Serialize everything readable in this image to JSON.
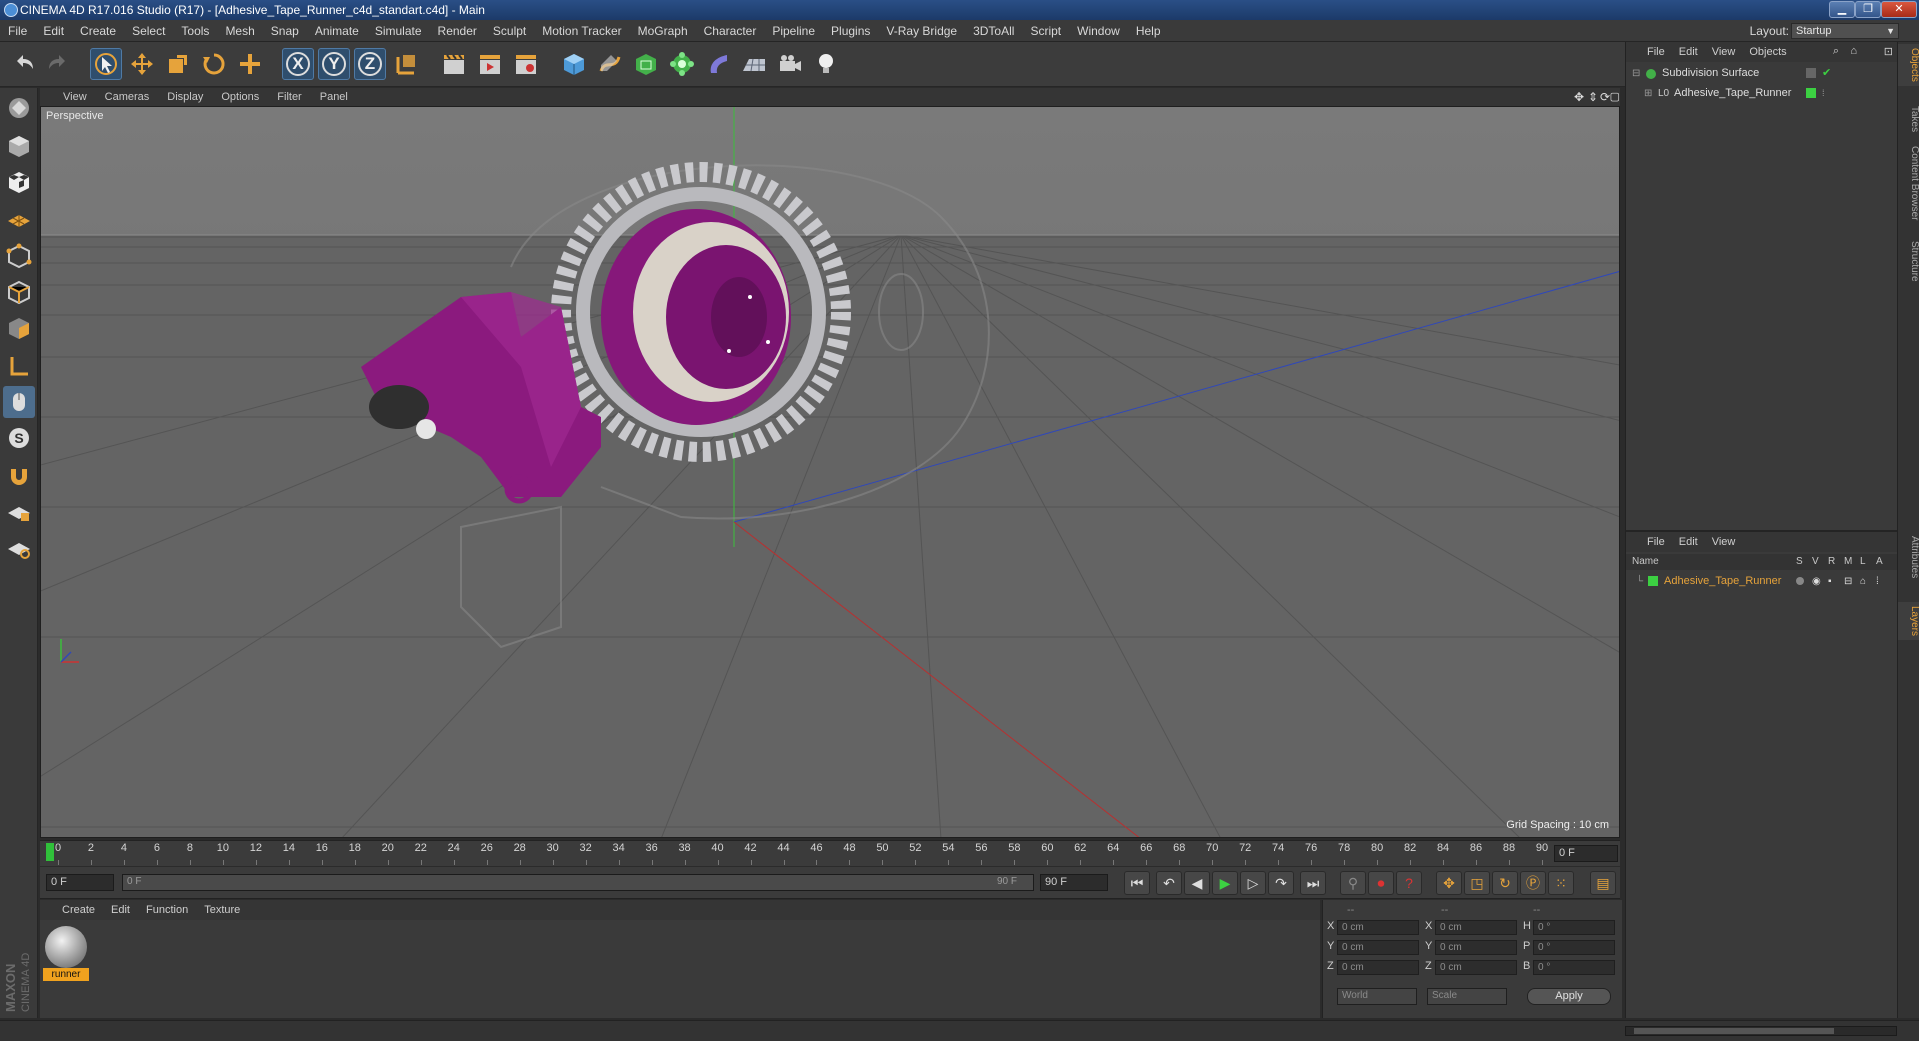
{
  "window": {
    "title": "CINEMA 4D R17.016 Studio (R17) - [Adhesive_Tape_Runner_c4d_standart.c4d] - Main",
    "minimize": "▁",
    "maximize": "❐",
    "close": "✕"
  },
  "menubar": {
    "items": [
      "File",
      "Edit",
      "Create",
      "Select",
      "Tools",
      "Mesh",
      "Snap",
      "Animate",
      "Simulate",
      "Render",
      "Sculpt",
      "Motion Tracker",
      "MoGraph",
      "Character",
      "Pipeline",
      "Plugins",
      "V-Ray Bridge",
      "3DToAll",
      "Script",
      "Window",
      "Help"
    ],
    "layout_label": "Layout:",
    "layout_value": "Startup"
  },
  "toolbar": {
    "axis_x": "X",
    "axis_y": "Y",
    "axis_z": "Z"
  },
  "viewport": {
    "menu": [
      "View",
      "Cameras",
      "Display",
      "Options",
      "Filter",
      "Panel"
    ],
    "label": "Perspective",
    "grid_spacing": "Grid Spacing : 10 cm",
    "colors": {
      "object": "#8a1a7c",
      "gear": "#c8c8cc",
      "ghost": "#8c8c8c"
    }
  },
  "timeline": {
    "ticks": [
      "0",
      "2",
      "4",
      "6",
      "8",
      "10",
      "12",
      "14",
      "16",
      "18",
      "20",
      "22",
      "24",
      "26",
      "28",
      "30",
      "32",
      "34",
      "36",
      "38",
      "40",
      "42",
      "44",
      "46",
      "48",
      "50",
      "52",
      "54",
      "56",
      "58",
      "60",
      "62",
      "64",
      "66",
      "68",
      "70",
      "72",
      "74",
      "76",
      "78",
      "80",
      "82",
      "84",
      "86",
      "88",
      "90"
    ],
    "current_frame": "0 F"
  },
  "transport": {
    "start_field": "0 F",
    "range_start": "0 F",
    "range_end": "90 F",
    "end_field": "90 F"
  },
  "materials": {
    "menu": [
      "Create",
      "Edit",
      "Function",
      "Texture"
    ],
    "items": [
      {
        "name": "runner"
      }
    ]
  },
  "coordinates": {
    "header": [
      "--",
      "--",
      "--"
    ],
    "rows": [
      {
        "a": "X",
        "av": "0 cm",
        "b": "X",
        "bv": "0 cm",
        "c": "H",
        "cv": "0 °"
      },
      {
        "a": "Y",
        "av": "0 cm",
        "b": "Y",
        "bv": "0 cm",
        "c": "P",
        "cv": "0 °"
      },
      {
        "a": "Z",
        "av": "0 cm",
        "b": "Z",
        "bv": "0 cm",
        "c": "B",
        "cv": "0 °"
      }
    ],
    "mode_world": "World",
    "mode_scale": "Scale",
    "apply": "Apply"
  },
  "object_manager": {
    "menu": [
      "File",
      "Edit",
      "View",
      "Objects"
    ],
    "objects": [
      {
        "name": "Subdivision Surface"
      },
      {
        "name": "Adhesive_Tape_Runner"
      }
    ]
  },
  "layer_manager": {
    "menu": [
      "File",
      "Edit",
      "View"
    ],
    "header": {
      "name": "Name",
      "s": "S",
      "v": "V",
      "r": "R",
      "m": "M",
      "l": "L",
      "a": "A"
    },
    "layers": [
      {
        "name": "Adhesive_Tape_Runner"
      }
    ]
  },
  "side_tabs": [
    "Objects",
    "Takes",
    "Content Browser",
    "Structure",
    "Attributes",
    "Layers"
  ],
  "logo": {
    "brand": "MAXON",
    "product": "CINEMA 4D"
  }
}
